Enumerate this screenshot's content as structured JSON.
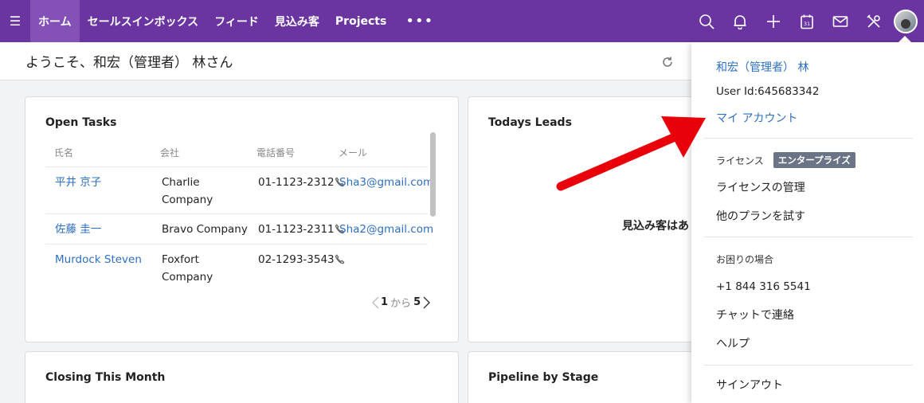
{
  "nav": {
    "items": [
      {
        "label": "ホーム",
        "active": true
      },
      {
        "label": "セールスインボックス",
        "active": false
      },
      {
        "label": "フィード",
        "active": false
      },
      {
        "label": "見込み客",
        "active": false
      },
      {
        "label": "Projects",
        "active": false
      }
    ],
    "more": "•••",
    "icons": [
      "search-icon",
      "bell-icon",
      "plus-icon",
      "calendar-icon",
      "mail-icon",
      "tools-icon"
    ],
    "calendar_day": "31",
    "accent": "#6a35a0"
  },
  "greeting": "ようこそ、和宏（管理者） 林さん",
  "open_tasks": {
    "title": "Open Tasks",
    "columns": [
      "氏名",
      "会社",
      "電話番号",
      "メール"
    ],
    "rows": [
      {
        "name": "平井 京子",
        "company": "Charlie Company",
        "phone": "01-1123-2312",
        "email": "Sha3@gmail.com"
      },
      {
        "name": "佐藤 圭一",
        "company": "Bravo Company",
        "phone": "01-1123-2311",
        "email": "Sha2@gmail.com"
      },
      {
        "name": "Murdock Steven",
        "company": "Foxfort Company",
        "phone": "02-1293-3543",
        "email": ""
      }
    ],
    "pager": {
      "current": "1",
      "sep": "から",
      "total": "5"
    }
  },
  "todays_leads": {
    "title": "Todays Leads",
    "empty": "見込み客はあ"
  },
  "closing_this_month": {
    "title": "Closing This Month"
  },
  "pipeline_by_stage": {
    "title": "Pipeline by Stage"
  },
  "menu": {
    "user_name": "和宏（管理者） 林",
    "user_id": "User Id:645683342",
    "my_account": "マイ アカウント",
    "license_label": "ライセンス",
    "license_badge": "エンタープライズ",
    "manage_license": "ライセンスの管理",
    "try_other_plans": "他のプランを試す",
    "help_heading": "お困りの場合",
    "phone": "+1 844 316 5541",
    "chat": "チャットで連絡",
    "help": "ヘルプ",
    "sign_out": "サインアウト"
  },
  "annotation_color": "#e8000b"
}
